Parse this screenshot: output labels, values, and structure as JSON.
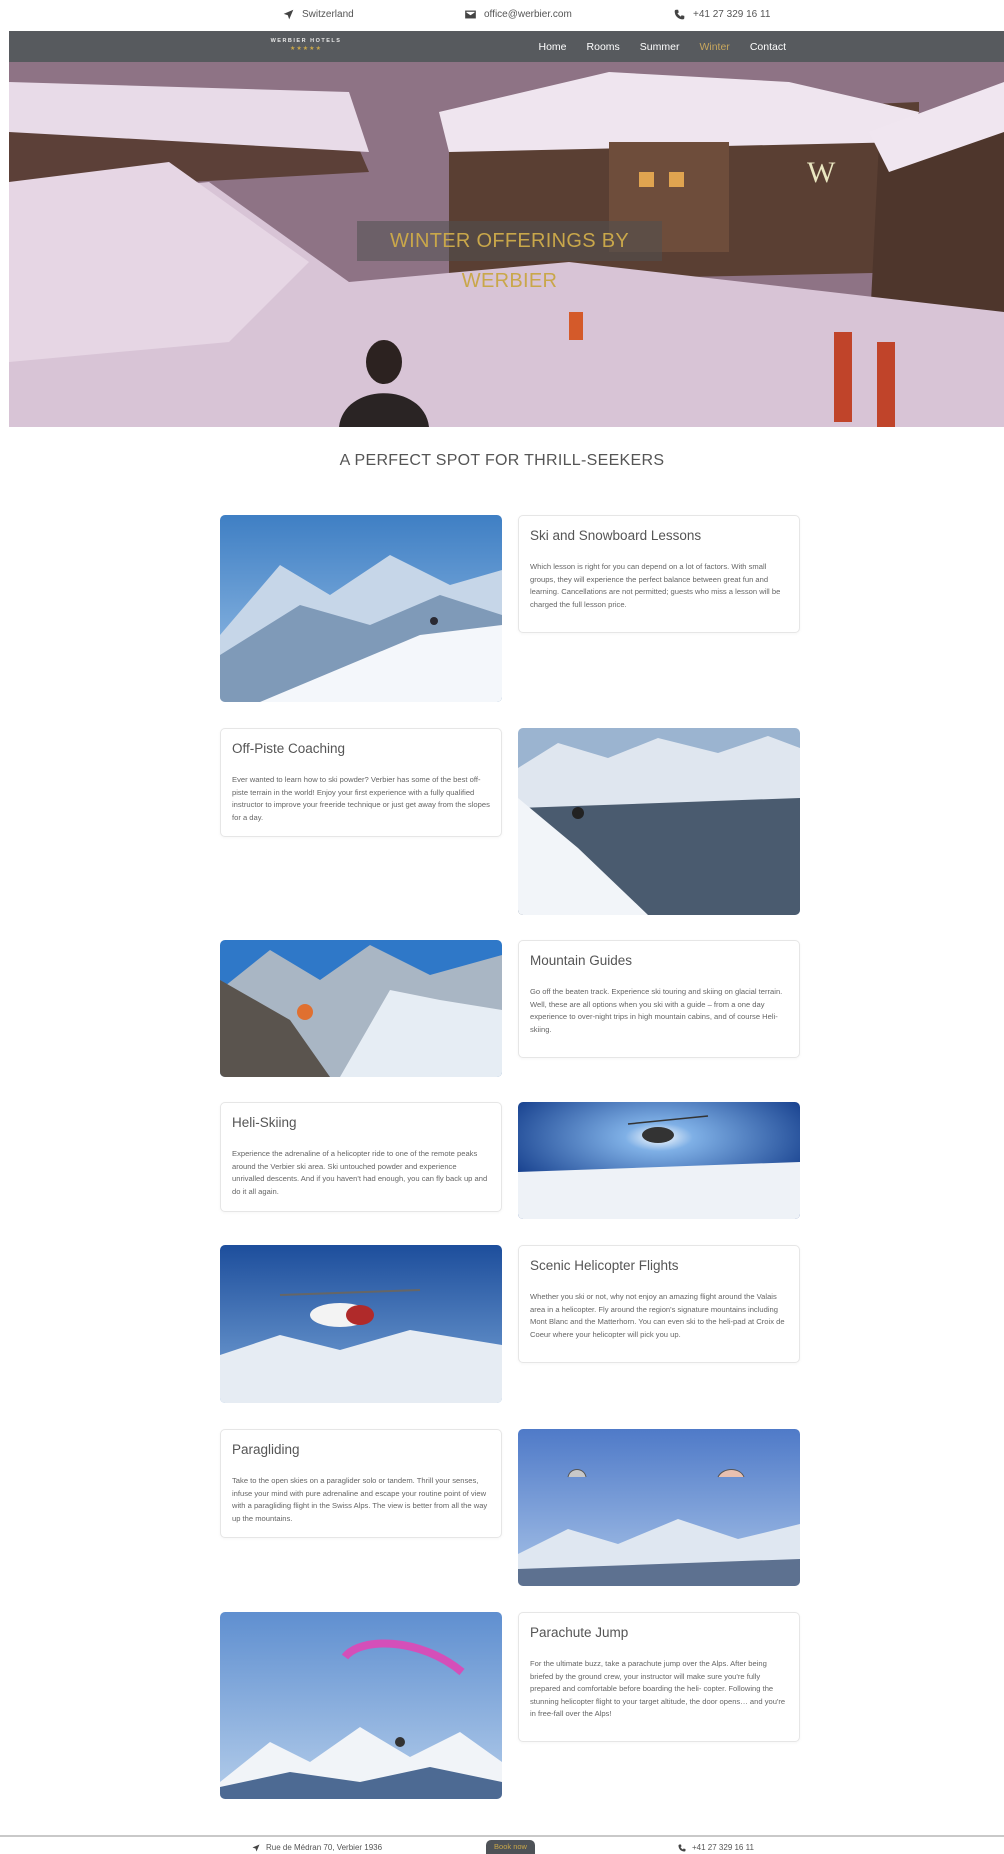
{
  "topbar": {
    "location": "Switzerland",
    "email": "office@werbier.com",
    "phone": "+41 27 329 16 11"
  },
  "nav": {
    "logo_text": "WERBIER HOTELS",
    "logo_stars": "★★★★★",
    "items": [
      {
        "label": "Home",
        "active": false
      },
      {
        "label": "Rooms",
        "active": false
      },
      {
        "label": "Summer",
        "active": false
      },
      {
        "label": "Winter",
        "active": true
      },
      {
        "label": "Contact",
        "active": false
      }
    ],
    "active_color": "#c7a65d"
  },
  "hero": {
    "title": "WINTER OFFERINGS BY WERBIER"
  },
  "section_title": "A PERFECT SPOT FOR THRILL-SEEKERS",
  "offerings": [
    {
      "title": "Ski and Snowboard Lessons",
      "text": "Which lesson is right for you can depend on a lot of factors. With small groups, they will experience the perfect balance between great fun and learning. Cancellations are not permitted; guests who miss a lesson will be charged the full lesson price."
    },
    {
      "title": "Off-Piste Coaching",
      "text": "Ever wanted to learn how to ski powder? Verbier has some of the best off-piste terrain in the world! Enjoy your first experience with a fully qualified instructor to improve your freeride technique or just get away from the slopes for a day."
    },
    {
      "title": "Mountain Guides",
      "text": "Go off the beaten track. Experience ski touring and skiing on glacial terrain. Well, these are all options when you ski with a guide – from a one day experience to over-night trips in high mountain cabins, and of course Heli-skiing."
    },
    {
      "title": "Heli-Skiing",
      "text": "Experience the adrenaline of a helicopter ride to one of the remote peaks around the Verbier ski area. Ski untouched powder and experience unrivalled descents. And if you haven't had enough, you can fly back up and do it all again."
    },
    {
      "title": "Scenic Helicopter Flights",
      "text": "Whether you ski or not, why not enjoy an amazing flight around the Valais area in a helicopter. Fly around the region's signature mountains including Mont Blanc and the Matterhorn. You can even ski to the heli-pad at Croix de Coeur where your helicopter will pick you up."
    },
    {
      "title": "Paragliding",
      "text": "Take to the open skies on a paraglider solo or tandem. Thrill your senses, infuse your mind with pure adrenaline and escape your routine point of view with a paragliding flight in the Swiss Alps. The view is better from all the way up the mountains."
    },
    {
      "title": "Parachute Jump",
      "text": "For the ultimate buzz, take a parachute jump over the Alps. After being briefed by the ground crew, your instructor will make sure you're fully prepared and comfortable before boarding the heli- copter. Following the stunning helicopter flight to your target altitude, the door opens… and you're in free-fall over the Alps!"
    }
  ],
  "footer": {
    "address": "Rue de Médran 70, Verbier 1936",
    "book_label": "Book now",
    "phone": "+41 27 329 16 11"
  }
}
